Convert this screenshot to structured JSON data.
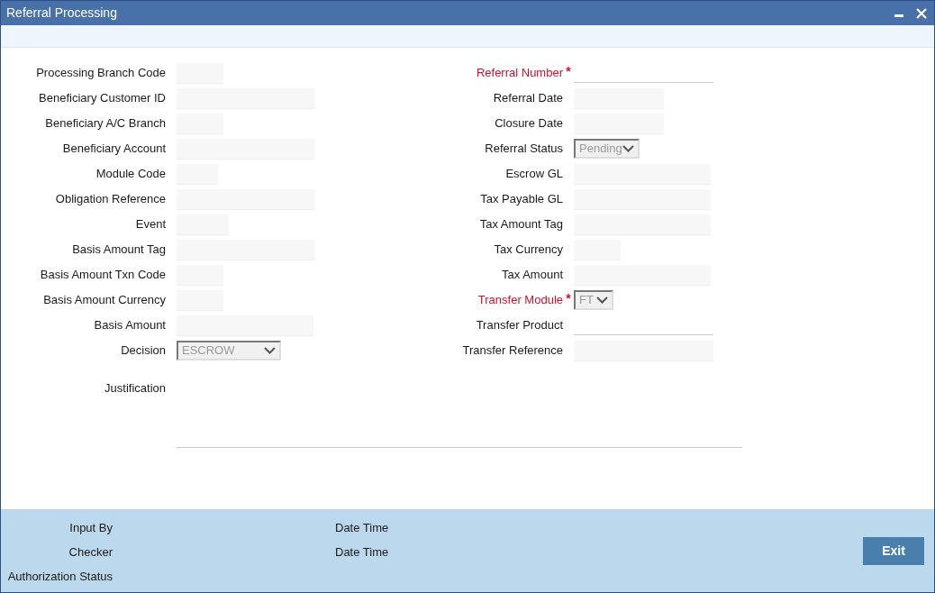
{
  "window": {
    "title": "Referral Processing"
  },
  "left_fields": [
    {
      "label": "Processing Branch Code",
      "kind": "text"
    },
    {
      "label": "Beneficiary Customer ID",
      "kind": "text"
    },
    {
      "label": "Beneficiary A/C Branch",
      "kind": "text"
    },
    {
      "label": "Beneficiary Account",
      "kind": "text"
    },
    {
      "label": "Module Code",
      "kind": "text"
    },
    {
      "label": "Obligation Reference",
      "kind": "text"
    },
    {
      "label": "Event",
      "kind": "text"
    },
    {
      "label": "Basis Amount Tag",
      "kind": "text"
    },
    {
      "label": "Basis Amount Txn Code",
      "kind": "text"
    },
    {
      "label": "Basis Amount Currency",
      "kind": "text"
    },
    {
      "label": "Basis Amount",
      "kind": "text"
    },
    {
      "label": "Decision",
      "kind": "select",
      "value": "ESCROW",
      "disabled": true
    }
  ],
  "right_fields": [
    {
      "label": "Referral Number",
      "mark": "*",
      "required": true,
      "kind": "underline"
    },
    {
      "label": "Referral Date",
      "kind": "text"
    },
    {
      "label": "Closure Date",
      "kind": "text"
    },
    {
      "label": "Referral Status",
      "kind": "select",
      "value": "Pending",
      "disabled": true
    },
    {
      "label": "Escrow GL",
      "kind": "text"
    },
    {
      "label": "Tax Payable GL",
      "kind": "text"
    },
    {
      "label": "Tax Amount Tag",
      "kind": "text"
    },
    {
      "label": "Tax Currency",
      "kind": "text"
    },
    {
      "label": "Tax Amount",
      "kind": "text"
    },
    {
      "label": "Transfer Module",
      "mark": "*",
      "required": true,
      "kind": "select",
      "value": "FT",
      "disabled": true
    },
    {
      "label": "Transfer Product",
      "kind": "underline"
    },
    {
      "label": "Transfer Reference",
      "kind": "text"
    }
  ],
  "justification": {
    "label": "Justification"
  },
  "footer": {
    "rows": [
      {
        "label": "Input By",
        "date_label": "Date Time"
      },
      {
        "label": "Checker",
        "date_label": "Date Time"
      },
      {
        "label": "Authorization Status"
      }
    ],
    "exit_button": "Exit"
  }
}
